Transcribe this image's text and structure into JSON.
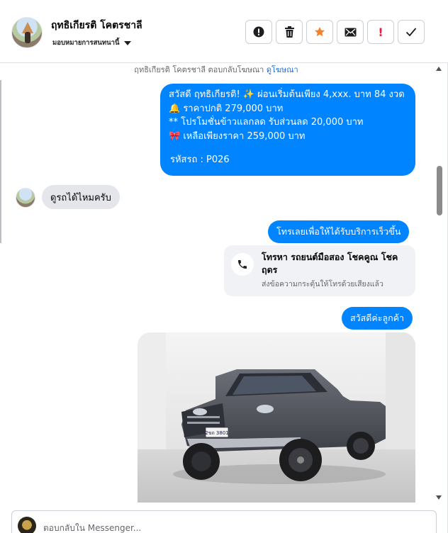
{
  "header": {
    "contact_name": "ฤทธิเกียรติ โคตรชาลี",
    "assign_label": "มอบหมายการสนทนานี้",
    "actions": [
      {
        "name": "report-button",
        "icon": "alert-circle-icon"
      },
      {
        "name": "delete-button",
        "icon": "trash-icon"
      },
      {
        "name": "star-button",
        "icon": "star-icon"
      },
      {
        "name": "mark-unread-button",
        "icon": "envelope-icon"
      },
      {
        "name": "priority-button",
        "icon": "exclamation-icon",
        "glyph": "!"
      },
      {
        "name": "done-button",
        "icon": "checkmark-icon",
        "glyph": "✓"
      }
    ],
    "colors": {
      "star": "#f5822a",
      "priority": "#e41e3f"
    }
  },
  "thread": {
    "reply_note": "ฤทธิเกียรติ โคตรชาลี ตอบกลับโฆษณา",
    "reply_note_link": "ดูโฆษณา",
    "messages": {
      "greeting": {
        "line1": "สวัสดี ฤทธิเกียรติ! ✨  ผ่อนเริ่มต้นเพียง 4,xxx. บาท 84 งวด",
        "line2": "🔔 ราคาปกติ 279,000 บาท",
        "line3": "** โปรโมชั่นข้าวแลกลด รับส่วนลด 20,000 บาท",
        "line4": "🎀  เหลือเพียงราคา 259,000 บาท",
        "code": "รหัสรถ : P026"
      },
      "customer_question": "ดูรถได้ไหมครับ",
      "call_prompt": "โทรเลยเพื่อให้ได้รับบริการเร็วขึ้น",
      "call_card": {
        "title": "โทรหา รถยนต์มือสอง โชคคูณ โชค ฤดร",
        "subtitle": "ส่งข้อความกระตุ้นให้โทรด้วยเสียงแล้ว"
      },
      "welcome": "สวัสดีค่ะลูกค้า",
      "photo_plate": "2ขถ 3801"
    },
    "colors": {
      "outgoing_bubble": "#0084ff",
      "incoming_bubble": "#e4e6eb"
    }
  },
  "composer": {
    "placeholder": "ตอบกลับใน Messenger..."
  }
}
